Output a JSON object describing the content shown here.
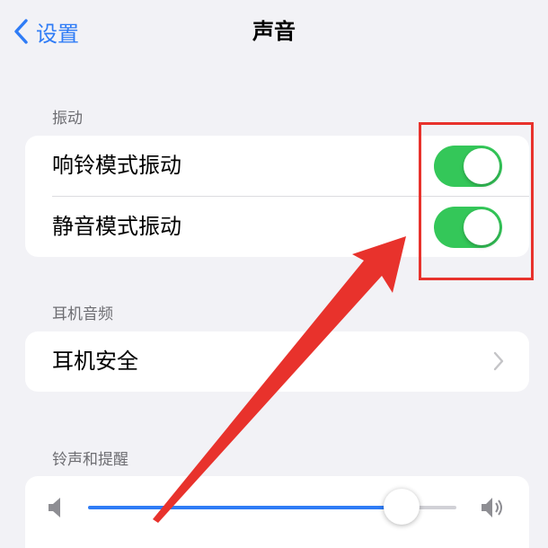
{
  "nav": {
    "back_label": "设置",
    "title": "声音"
  },
  "vibration": {
    "header": "振动",
    "rows": [
      {
        "label": "响铃模式振动",
        "toggle_on": true
      },
      {
        "label": "静音模式振动",
        "toggle_on": true
      }
    ]
  },
  "headphone_audio": {
    "header": "耳机音频",
    "safety_label": "耳机安全"
  },
  "ringtones": {
    "header": "铃声和提醒",
    "volume_level": 0.85
  },
  "colors": {
    "accent": "#2f7cf6",
    "toggle_on": "#34c759",
    "annotation": "#e8322c"
  },
  "icons": {
    "back": "chevron-left-icon",
    "disclosure": "chevron-right-icon",
    "volume_low": "speaker-low-icon",
    "volume_high": "speaker-high-icon"
  }
}
